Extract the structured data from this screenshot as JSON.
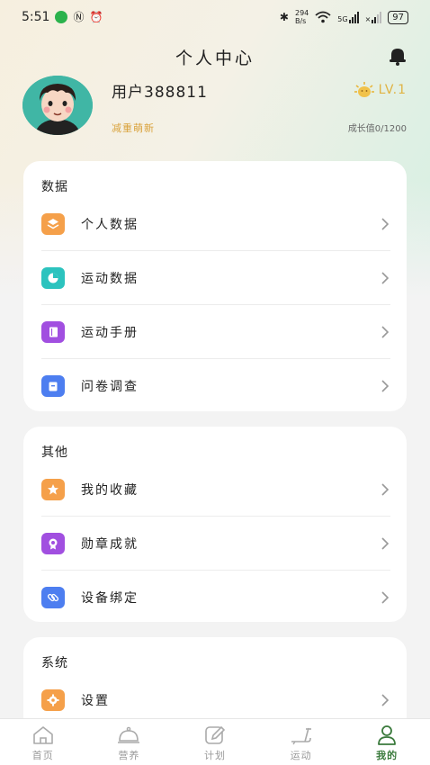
{
  "status": {
    "time": "5:51",
    "net_speed_top": "294",
    "net_speed_unit": "B/s",
    "network": "5G",
    "battery": "97"
  },
  "header": {
    "title": "个人中心"
  },
  "profile": {
    "username": "用户388811",
    "tagline": "减重萌新",
    "level": "LV.1",
    "growth": "成长值0/1200"
  },
  "sections": {
    "data": {
      "title": "数据",
      "items": [
        {
          "label": "个人数据",
          "icon": "layers-icon",
          "color": "#f5a04a"
        },
        {
          "label": "运动数据",
          "icon": "pie-chart-icon",
          "color": "#2cc3be"
        },
        {
          "label": "运动手册",
          "icon": "notebook-icon",
          "color": "#a14fe0"
        },
        {
          "label": "问卷调查",
          "icon": "clipboard-icon",
          "color": "#4d7ef0"
        }
      ]
    },
    "other": {
      "title": "其他",
      "items": [
        {
          "label": "我的收藏",
          "icon": "star-icon",
          "color": "#f5a04a"
        },
        {
          "label": "勋章成就",
          "icon": "medal-icon",
          "color": "#a14fe0"
        },
        {
          "label": "设备绑定",
          "icon": "link-icon",
          "color": "#4d7ef0"
        }
      ]
    },
    "system": {
      "title": "系统",
      "items": [
        {
          "label": "设置",
          "icon": "gear-icon",
          "color": "#f5a04a"
        }
      ]
    }
  },
  "tabbar": {
    "tabs": [
      {
        "label": "首页",
        "icon": "home-icon"
      },
      {
        "label": "营养",
        "icon": "cloche-icon"
      },
      {
        "label": "计划",
        "icon": "edit-icon"
      },
      {
        "label": "运动",
        "icon": "treadmill-icon"
      },
      {
        "label": "我的",
        "icon": "person-icon",
        "active": true
      }
    ]
  },
  "colors": {
    "accent_green": "#3a7a3c",
    "level_gold": "#e0b343"
  }
}
